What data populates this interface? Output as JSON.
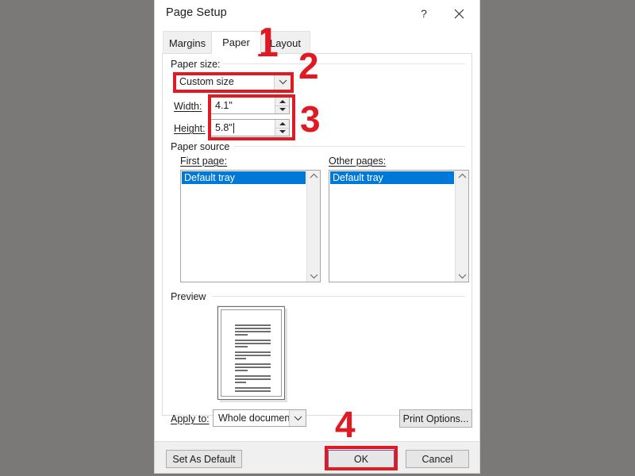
{
  "window": {
    "title": "Page Setup",
    "help_icon": "question-mark-icon",
    "close_icon": "close-icon"
  },
  "tabs": [
    {
      "label": "Margins",
      "selected": false
    },
    {
      "label": "Paper",
      "selected": true
    },
    {
      "label": "Layout",
      "selected": false
    }
  ],
  "paper_size": {
    "group_label": "Paper size:",
    "size_value": "Custom size",
    "width_label": "Width:",
    "width_value": "4.1\"",
    "height_label": "Height:",
    "height_value": "5.8\""
  },
  "paper_source": {
    "group_label": "Paper source",
    "first_page_label": "First page:",
    "first_page_items": [
      "Default tray"
    ],
    "first_page_selected": "Default tray",
    "other_pages_label": "Other pages:",
    "other_pages_items": [
      "Default tray"
    ],
    "other_pages_selected": "Default tray"
  },
  "preview": {
    "group_label": "Preview"
  },
  "apply": {
    "label": "Apply to:",
    "value": "Whole document",
    "print_options_label": "Print Options..."
  },
  "footer": {
    "set_as_default_label": "Set As Default",
    "ok_label": "OK",
    "cancel_label": "Cancel"
  },
  "annotations": {
    "accent_color": "#e01a22",
    "steps": [
      {
        "number": "1"
      },
      {
        "number": "2"
      },
      {
        "number": "3"
      },
      {
        "number": "4"
      }
    ]
  }
}
